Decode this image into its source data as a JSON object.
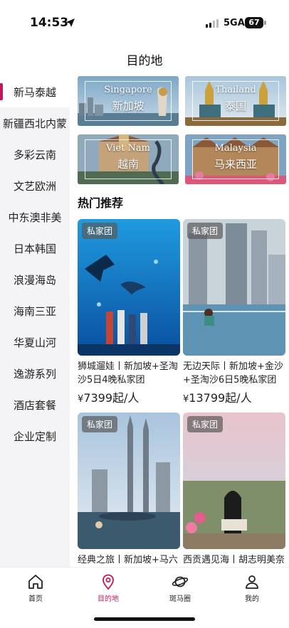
{
  "status_bar": {
    "time": "14:53",
    "network": "5GA",
    "battery": "67"
  },
  "header": {
    "title": "目的地"
  },
  "sidebar": {
    "items": [
      {
        "label": "新马泰越",
        "active": true
      },
      {
        "label": "新疆西北内蒙",
        "active": false
      },
      {
        "label": "多彩云南",
        "active": false
      },
      {
        "label": "文艺欧洲",
        "active": false
      },
      {
        "label": "中东澳非美",
        "active": false
      },
      {
        "label": "日本韩国",
        "active": false
      },
      {
        "label": "浪漫海岛",
        "active": false
      },
      {
        "label": "海南三亚",
        "active": false
      },
      {
        "label": "华夏山河",
        "active": false
      },
      {
        "label": "逸游系列",
        "active": false
      },
      {
        "label": "酒店套餐",
        "active": false
      },
      {
        "label": "企业定制",
        "active": false
      }
    ]
  },
  "destinations": [
    {
      "en": "Singapore",
      "zh": "新加坡"
    },
    {
      "en": "Thailand",
      "zh": "泰国"
    },
    {
      "en": "Viet Nam",
      "zh": "越南"
    },
    {
      "en": "Malaysia",
      "zh": "马来西亚"
    }
  ],
  "hot": {
    "title": "热门推荐",
    "products": [
      {
        "badge": "私家团",
        "title": "狮城遛娃丨新加坡+圣淘沙5日4晚私家团",
        "price_prefix": "¥",
        "price": "7399起/人"
      },
      {
        "badge": "私家团",
        "title": "无边天际丨新加坡+金沙+圣淘沙6日5晚私家团",
        "price_prefix": "¥",
        "price": "13799起/人"
      },
      {
        "badge": "私家团",
        "title": "经典之旅丨新加坡+马六甲",
        "price_prefix": "",
        "price": ""
      },
      {
        "badge": "私家团",
        "title": "西贡遇见海丨胡志明美奈",
        "price_prefix": "",
        "price": ""
      }
    ]
  },
  "tabbar": {
    "items": [
      {
        "label": "首页",
        "icon": "home-icon"
      },
      {
        "label": "目的地",
        "icon": "location-pin-icon",
        "active": true
      },
      {
        "label": "斑马圈",
        "icon": "planet-icon"
      },
      {
        "label": "我的",
        "icon": "user-icon"
      }
    ]
  },
  "colors": {
    "accent": "#c2185b",
    "sidebar_bg": "#f4f4f6"
  }
}
